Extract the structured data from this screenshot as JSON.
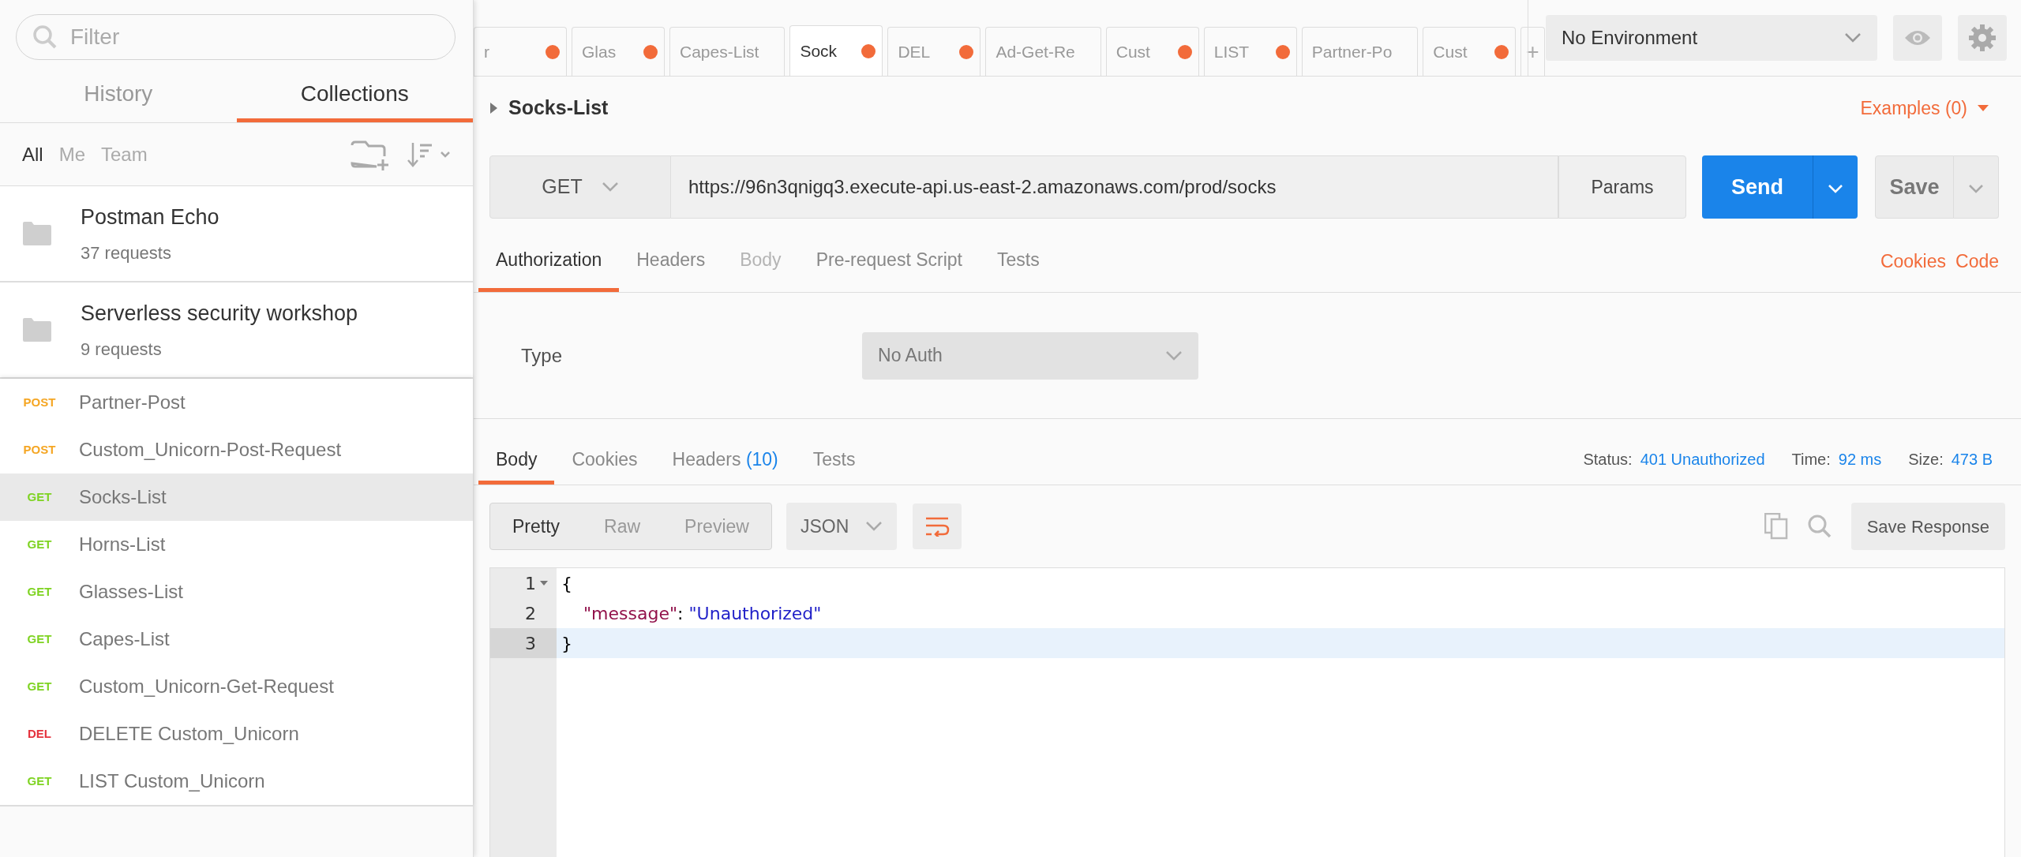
{
  "sidebar": {
    "search": {
      "placeholder": "Filter"
    },
    "tabs": [
      {
        "label": "History",
        "selected": false
      },
      {
        "label": "Collections",
        "selected": true
      }
    ],
    "filters": [
      {
        "label": "All",
        "selected": true
      },
      {
        "label": "Me",
        "selected": false
      },
      {
        "label": "Team",
        "selected": false
      }
    ],
    "collections": [
      {
        "name": "Postman Echo",
        "count": "37 requests"
      },
      {
        "name": "Serverless security workshop",
        "count": "9 requests"
      }
    ],
    "requests": [
      {
        "method": "POST",
        "color": "#f5a623",
        "name": "Partner-Post",
        "selected": false
      },
      {
        "method": "POST",
        "color": "#f5a623",
        "name": "Custom_Unicorn-Post-Request",
        "selected": false
      },
      {
        "method": "GET",
        "color": "#7ed321",
        "name": "Socks-List",
        "selected": true
      },
      {
        "method": "GET",
        "color": "#7ed321",
        "name": "Horns-List",
        "selected": false
      },
      {
        "method": "GET",
        "color": "#7ed321",
        "name": "Glasses-List",
        "selected": false
      },
      {
        "method": "GET",
        "color": "#7ed321",
        "name": "Capes-List",
        "selected": false
      },
      {
        "method": "GET",
        "color": "#7ed321",
        "name": "Custom_Unicorn-Get-Request",
        "selected": false
      },
      {
        "method": "DEL",
        "color": "#e5333e",
        "name": "DELETE Custom_Unicorn",
        "selected": false
      },
      {
        "method": "GET",
        "color": "#7ed321",
        "name": "LIST Custom_Unicorn",
        "selected": false
      }
    ]
  },
  "tabs": [
    {
      "label": "r",
      "selected": false,
      "unsaved": true
    },
    {
      "label": "Glas",
      "selected": false,
      "unsaved": true
    },
    {
      "label": "Capes-List",
      "selected": false,
      "unsaved": false
    },
    {
      "label": "Sock",
      "selected": true,
      "unsaved": true
    },
    {
      "label": "DEL",
      "selected": false,
      "unsaved": true
    },
    {
      "label": "Ad-Get-Re",
      "selected": false,
      "unsaved": false
    },
    {
      "label": "Cust",
      "selected": false,
      "unsaved": true
    },
    {
      "label": "LIST",
      "selected": false,
      "unsaved": true
    },
    {
      "label": "Partner-Po",
      "selected": false,
      "unsaved": false
    },
    {
      "label": "Cust",
      "selected": false,
      "unsaved": true
    }
  ],
  "new_tab": "+",
  "environment": {
    "value": "No Environment"
  },
  "request": {
    "title": "Socks-List",
    "examples": "Examples (0)",
    "method": "GET",
    "url": "https://96n3qnigq3.execute-api.us-east-2.amazonaws.com/prod/socks",
    "params": "Params",
    "send": "Send",
    "save": "Save",
    "tabs": [
      {
        "label": "Authorization",
        "selected": true,
        "disabled": false
      },
      {
        "label": "Headers",
        "selected": false,
        "disabled": false
      },
      {
        "label": "Body",
        "selected": false,
        "disabled": true
      },
      {
        "label": "Pre-request Script",
        "selected": false,
        "disabled": false
      },
      {
        "label": "Tests",
        "selected": false,
        "disabled": false
      }
    ],
    "links": [
      "Cookies",
      "Code"
    ],
    "auth": {
      "label": "Type",
      "value": "No Auth"
    }
  },
  "response": {
    "tabs": [
      {
        "label": "Body",
        "selected": true
      },
      {
        "label": "Cookies",
        "selected": false
      },
      {
        "label": "Headers",
        "count": "(10)",
        "selected": false
      },
      {
        "label": "Tests",
        "selected": false
      }
    ],
    "stats": [
      {
        "label": "Status:",
        "value": "401 Unauthorized"
      },
      {
        "label": "Time:",
        "value": "92 ms"
      },
      {
        "label": "Size:",
        "value": "473 B"
      }
    ],
    "views": [
      {
        "label": "Pretty",
        "selected": true
      },
      {
        "label": "Raw",
        "selected": false
      },
      {
        "label": "Preview",
        "selected": false
      }
    ],
    "format": "JSON",
    "save": "Save Response",
    "code": [
      {
        "number": "1",
        "foldable": true,
        "active": false,
        "tokens": [
          {
            "kind": "punct",
            "text": "{"
          }
        ]
      },
      {
        "number": "2",
        "foldable": false,
        "active": false,
        "tokens": [
          {
            "kind": "key",
            "text": "    \"message\""
          },
          {
            "kind": "punct",
            "text": ": "
          },
          {
            "kind": "string",
            "text": "\"Unauthorized\""
          }
        ]
      },
      {
        "number": "3",
        "foldable": false,
        "active": true,
        "tokens": [
          {
            "kind": "punct",
            "text": "}"
          }
        ]
      }
    ]
  }
}
